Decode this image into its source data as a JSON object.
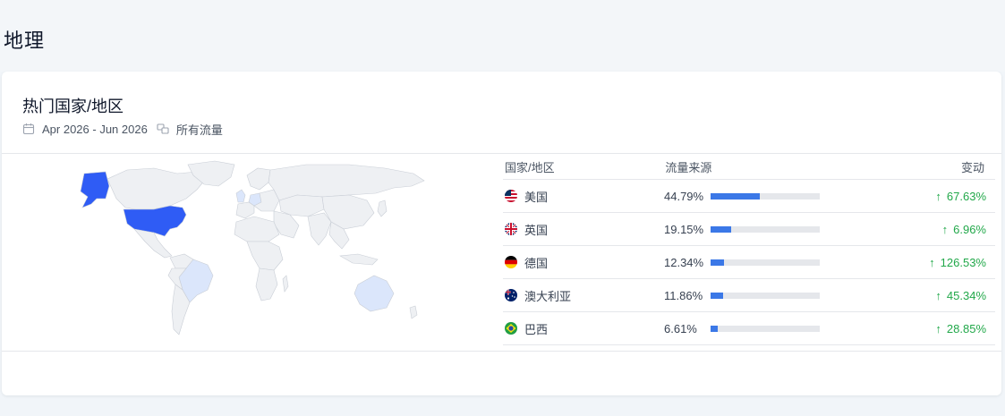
{
  "page": {
    "title": "地理"
  },
  "card": {
    "title": "热门国家/地区",
    "date_range": "Apr 2026 - Jun 2026",
    "traffic_filter": "所有流量"
  },
  "colors": {
    "bar_fill": "#3b78e7",
    "bar_track": "#e5e7eb",
    "positive": "#22a84a",
    "map_top": "#2f5cf5",
    "map_highlight": "#dbe6fb",
    "map_base": "#eef0f3"
  },
  "map": {
    "highlighted_countries": [
      "united-states",
      "united-kingdom",
      "germany",
      "australia",
      "brazil"
    ]
  },
  "table": {
    "headers": {
      "country": "国家/地区",
      "traffic": "流量来源",
      "change": "变动"
    },
    "rows": [
      {
        "flag": "us-flag-icon",
        "country": "美国",
        "traffic_pct": "44.79%",
        "share": 0.4479,
        "arrow": "↑",
        "change": "67.63%"
      },
      {
        "flag": "uk-flag-icon",
        "country": "英国",
        "traffic_pct": "19.15%",
        "share": 0.1915,
        "arrow": "↑",
        "change": "6.96%"
      },
      {
        "flag": "de-flag-icon",
        "country": "德国",
        "traffic_pct": "12.34%",
        "share": 0.1234,
        "arrow": "↑",
        "change": "126.53%"
      },
      {
        "flag": "au-flag-icon",
        "country": "澳大利亚",
        "traffic_pct": "11.86%",
        "share": 0.1186,
        "arrow": "↑",
        "change": "45.34%"
      },
      {
        "flag": "br-flag-icon",
        "country": "巴西",
        "traffic_pct": "6.61%",
        "share": 0.0661,
        "arrow": "↑",
        "change": "28.85%"
      }
    ]
  }
}
